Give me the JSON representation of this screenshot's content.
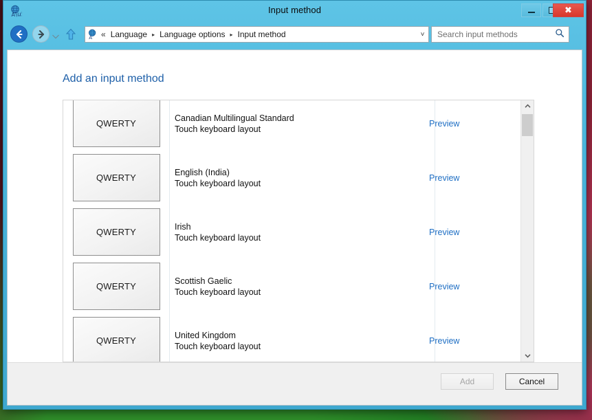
{
  "window": {
    "title": "Input method",
    "icon": "language-globe-icon",
    "controls": {
      "minimize": "minimize-button",
      "maximize": "maximize-button",
      "close": "close-button"
    }
  },
  "toolbar": {
    "back": "back-button",
    "forward": "forward-button",
    "history": "recent-locations-button",
    "up": "up-one-level-button",
    "address": {
      "icon": "language-globe-icon",
      "overflow": "«",
      "crumbs": [
        "Language",
        "Language options",
        "Input method"
      ],
      "separator": "▸",
      "dropdown": "˅"
    },
    "refresh": "↻",
    "search": {
      "placeholder": "Search input methods",
      "value": "",
      "icon": "search-icon"
    }
  },
  "content": {
    "heading": "Add an input method",
    "list": {
      "thumb_label": "QWERTY",
      "preview_label": "Preview",
      "items": [
        {
          "name": "Canadian Multilingual Standard",
          "sub": "Touch keyboard layout"
        },
        {
          "name": "English (India)",
          "sub": "Touch keyboard layout"
        },
        {
          "name": "Irish",
          "sub": "Touch keyboard layout"
        },
        {
          "name": "Scottish Gaelic",
          "sub": "Touch keyboard layout"
        },
        {
          "name": "United Kingdom",
          "sub": "Touch keyboard layout"
        }
      ]
    },
    "scrollbar": {
      "up_arrow": "⌃",
      "down_arrow": "⌄"
    }
  },
  "footer": {
    "add_label": "Add",
    "cancel_label": "Cancel"
  },
  "colors": {
    "frame": "#3ea8cf",
    "heading": "#1d5fa8",
    "link": "#1f6fc4",
    "close": "#d8372c"
  }
}
